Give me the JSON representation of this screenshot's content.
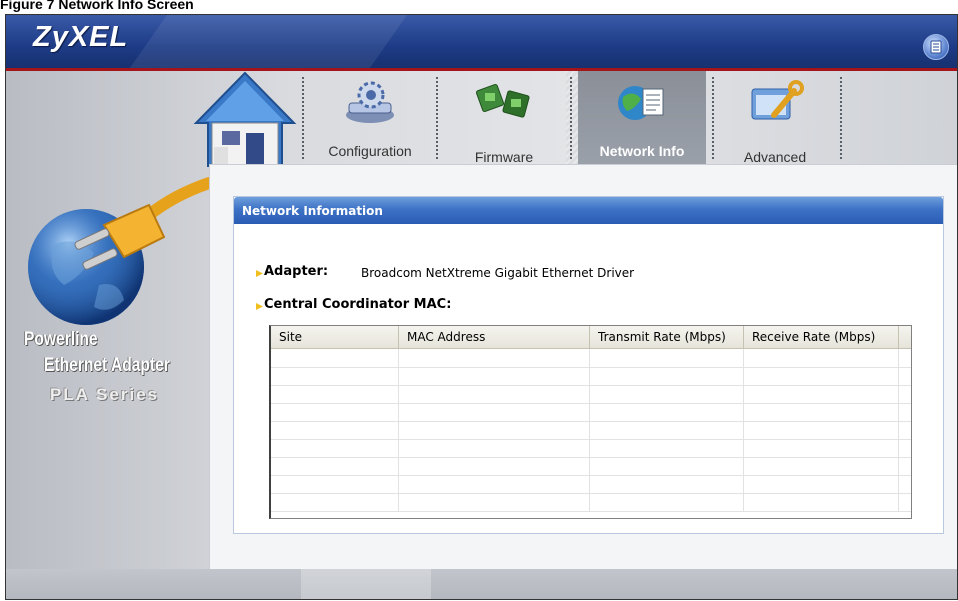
{
  "caption": {
    "text": "Figure 7    Network Info Screen"
  },
  "header": {
    "logo": "ZyXEL"
  },
  "branding": {
    "line1": "Powerline",
    "line2": "Ethernet Adapter",
    "line3": "PLA Series"
  },
  "nav": {
    "tabs": [
      {
        "label": "Configuration",
        "active": false
      },
      {
        "label": "Firmware",
        "active": false
      },
      {
        "label": "Network Info",
        "active": true
      },
      {
        "label": "Advanced",
        "active": false
      }
    ]
  },
  "panel": {
    "title": "Network Information",
    "adapter_label": "Adapter:",
    "adapter_value": "Broadcom NetXtreme Gigabit Ethernet Driver",
    "ccmac_label": "Central Coordinator MAC:"
  },
  "table": {
    "columns": [
      "Site",
      "MAC Address",
      "Transmit Rate (Mbps)",
      "Receive Rate (Mbps)"
    ],
    "rows": []
  },
  "colors": {
    "header_blue": "#1d3b86",
    "accent_red": "#a3141b",
    "titlebar_blue": "#3d72c6",
    "bullet_yellow": "#f0c020"
  }
}
